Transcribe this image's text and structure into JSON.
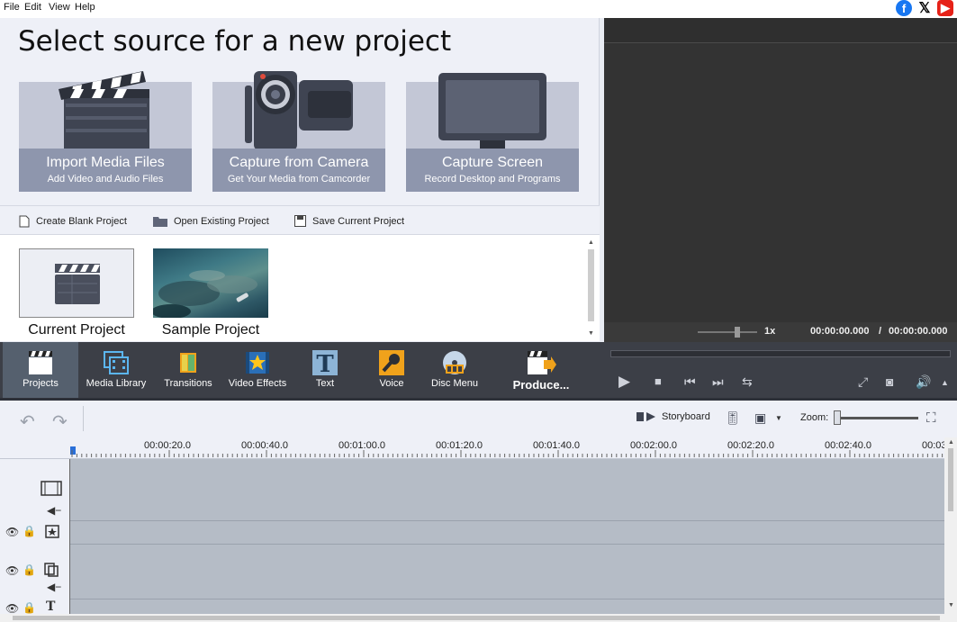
{
  "menu": [
    "File",
    "Edit",
    "View",
    "Help"
  ],
  "source": {
    "title": "Select source for a new project",
    "cards": [
      {
        "main": "Import Media Files",
        "sub": "Add Video and Audio Files"
      },
      {
        "main": "Capture from Camera",
        "sub": "Get Your Media from Camcorder"
      },
      {
        "main": "Capture Screen",
        "sub": "Record Desktop and Programs"
      }
    ]
  },
  "actions": {
    "create": "Create Blank Project",
    "open": "Open Existing Project",
    "save": "Save Current Project"
  },
  "projects": {
    "current": "Current Project",
    "sample": "Sample Project"
  },
  "preview": {
    "speed": "1x",
    "time_current": "00:00:00.000",
    "time_sep": "/",
    "time_total": "00:00:00.000"
  },
  "toolbar": {
    "projects": "Projects",
    "media_library": "Media Library",
    "transitions": "Transitions",
    "video_effects": "Video Effects",
    "text": "Text",
    "voice": "Voice",
    "disc_menu": "Disc Menu",
    "produce": "Produce..."
  },
  "timeline": {
    "storyboard": "Storyboard",
    "zoom": "Zoom:",
    "ticks": [
      "00:00:20.0",
      "00:00:40.0",
      "00:01:00.0",
      "00:01:20.0",
      "00:01:40.0",
      "00:02:00.0",
      "00:02:20.0",
      "00:02:40.0",
      "00:03"
    ]
  },
  "colors": {
    "toolbar_bg": "#3c3f47",
    "panel_bg": "#eef0f7",
    "preview_bg": "#333333",
    "track_bg": "#b5bcc6",
    "accent_orange": "#f0a21b"
  }
}
